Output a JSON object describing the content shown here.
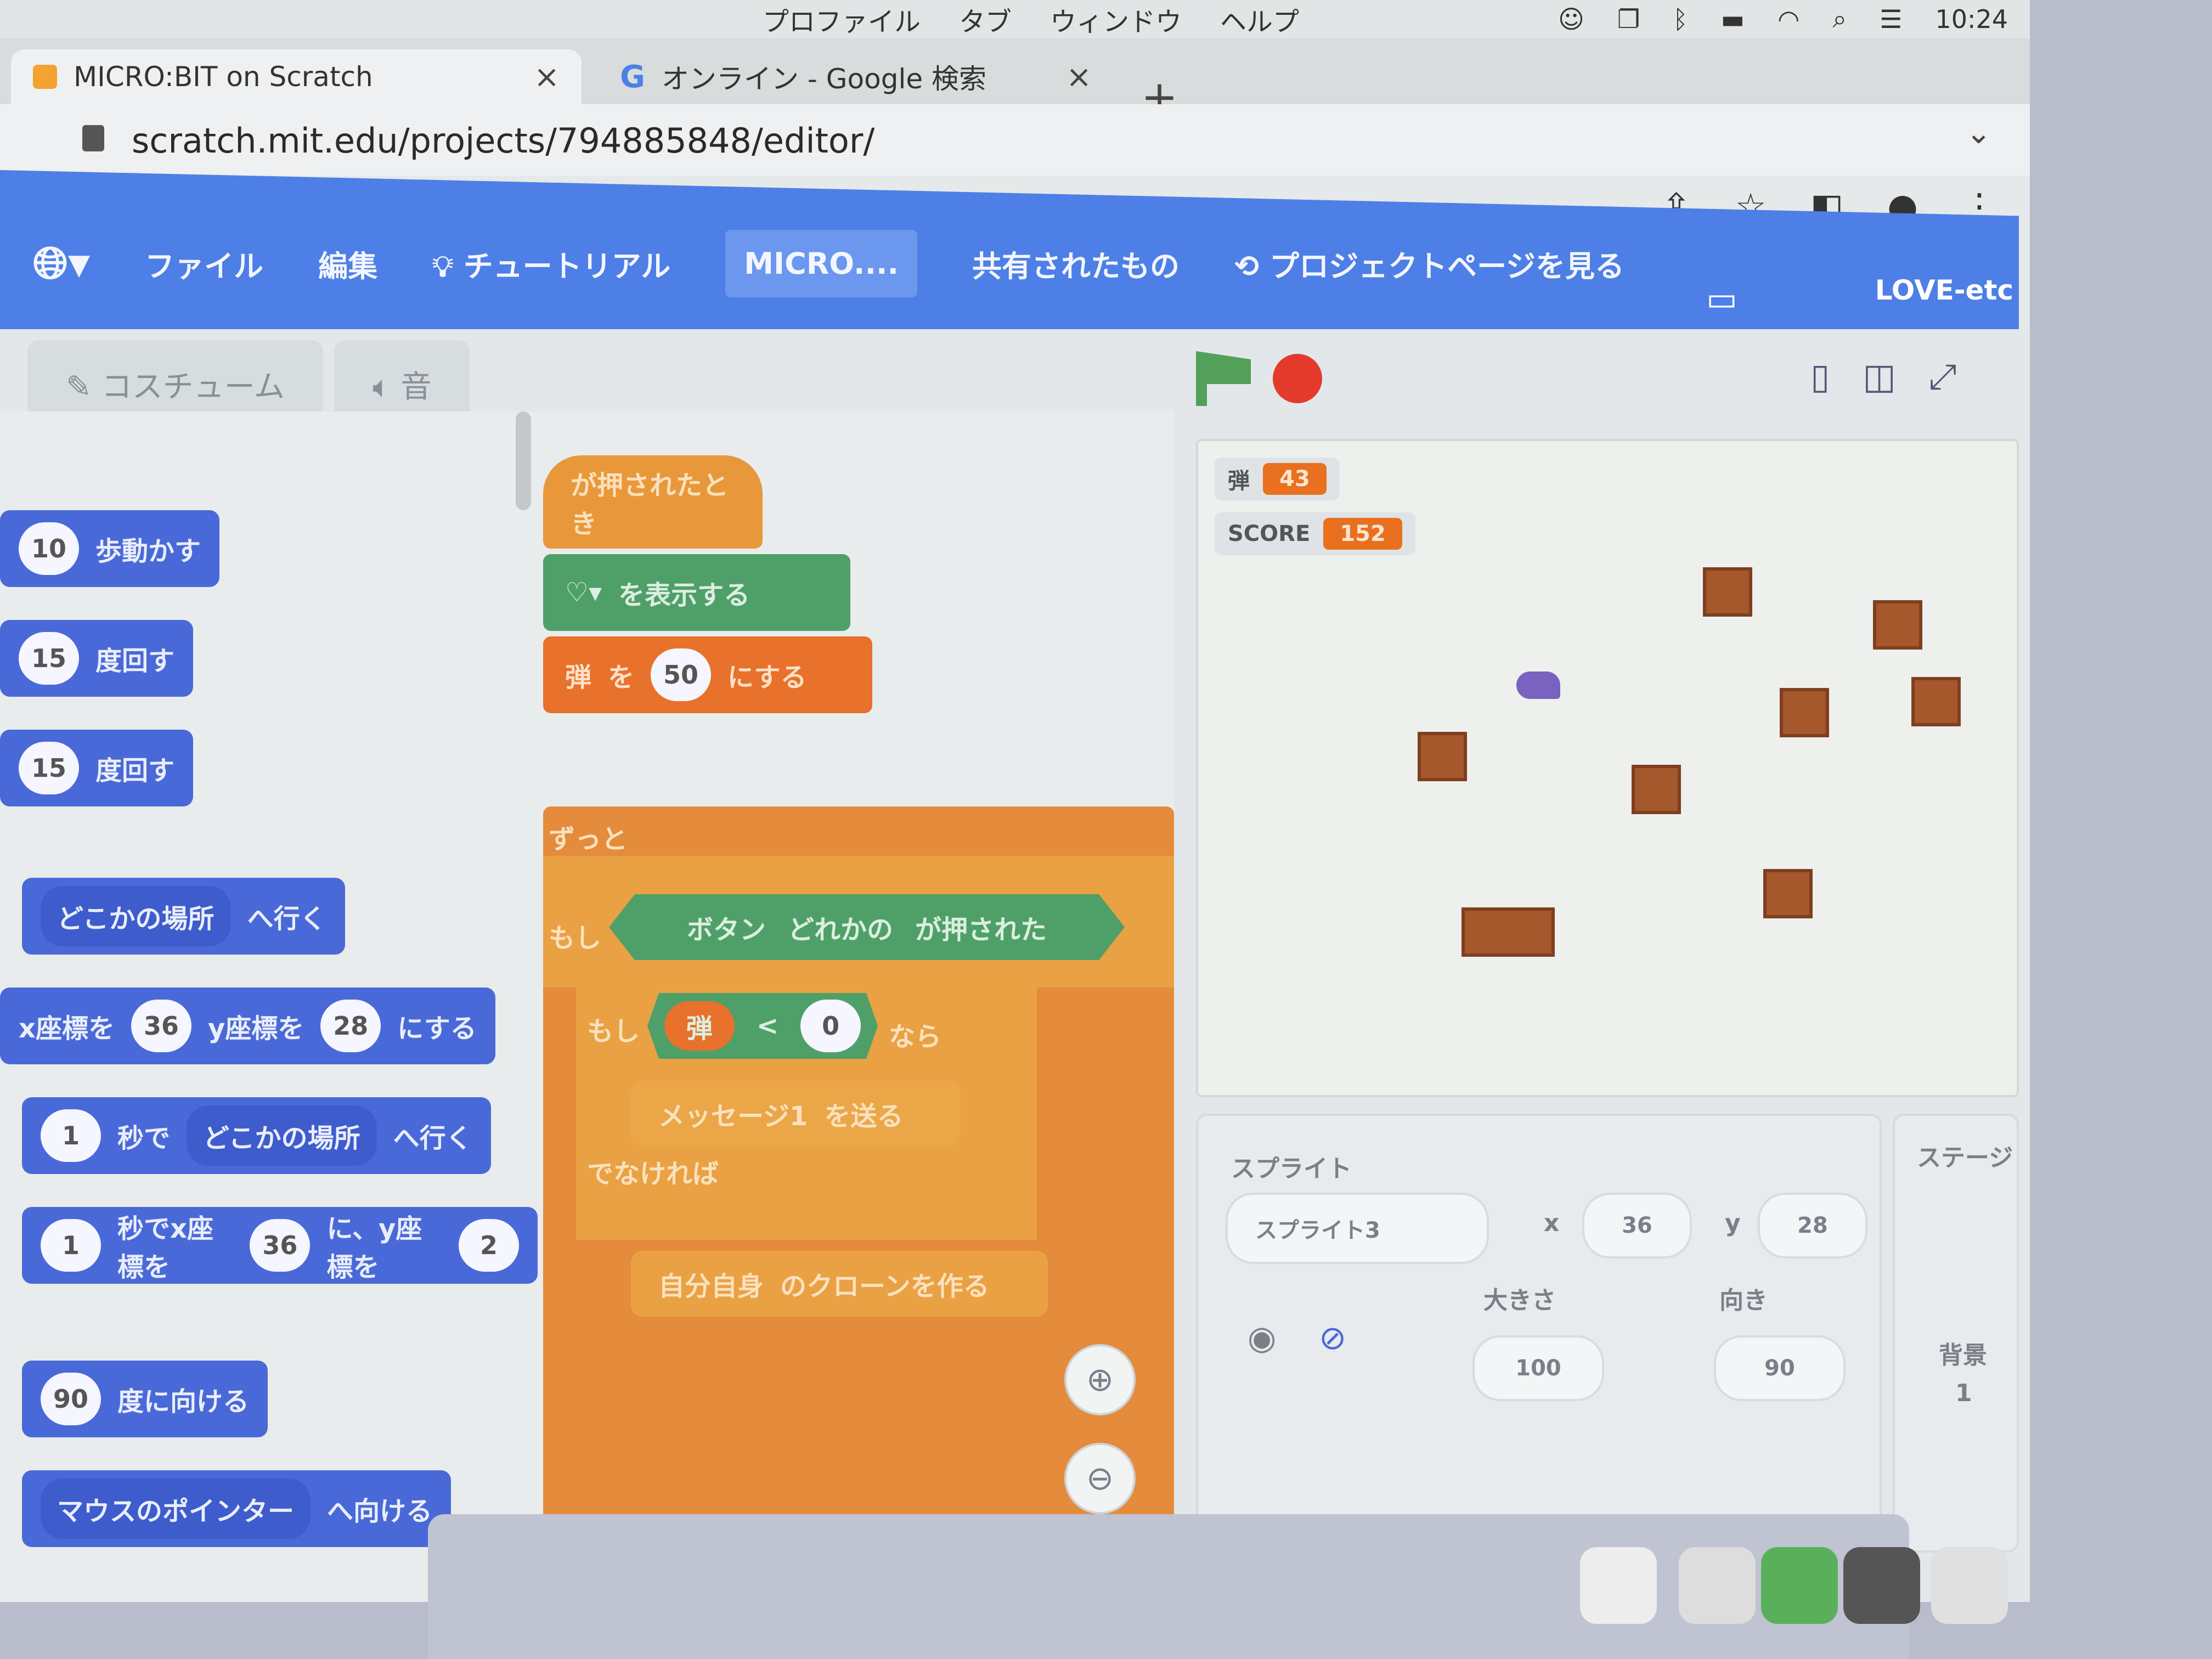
{
  "macos": {
    "menu_items": [
      "プロファイル",
      "タブ",
      "ウィンドウ",
      "ヘルプ"
    ],
    "clock": "10:24",
    "status_icons": [
      "user-icon",
      "window-icon",
      "bluetooth-icon",
      "battery-icon",
      "wifi-icon",
      "search-icon",
      "control-center-icon"
    ]
  },
  "browser": {
    "tabs": [
      {
        "title": "MICRO:BIT on Scratch",
        "close": "×"
      },
      {
        "title": "オンライン - Google 検索",
        "close": "×"
      }
    ],
    "new_tab": "+",
    "url": "scratch.mit.edu/projects/794885848/editor/"
  },
  "scratch_menu": {
    "file": "ファイル",
    "edit": "編集",
    "tutorials": "チュートリアル",
    "project_title": "MICRO....",
    "shared": "共有されたもの",
    "see_project_page": "プロジェクトページを見る",
    "user": "LOVE-etc"
  },
  "editor_tabs": {
    "costumes": "コスチューム",
    "sounds": "音"
  },
  "palette": {
    "move": {
      "value": "10",
      "label": "歩動かす"
    },
    "turn_right": {
      "value": "15",
      "label": "度回す"
    },
    "turn_left": {
      "value": "15",
      "label": "度回す"
    },
    "goto": {
      "dropdown": "どこかの場所",
      "label": "へ行く"
    },
    "set_xy": {
      "x_label": "x座標を",
      "x": "36",
      "y_label": "y座標を",
      "y": "28",
      "suffix": "にする"
    },
    "glide_random": {
      "secs": "1",
      "label": "秒で",
      "dropdown": "どこかの場所",
      "suffix": "へ行く"
    },
    "glide_xy": {
      "secs": "1",
      "label": "秒でx座標を",
      "x": "36",
      "mid": "に、y座標を",
      "y": "2"
    },
    "point_dir": {
      "value": "90",
      "label": "度に向ける"
    },
    "point_towards": {
      "dropdown": "マウスのポインター",
      "label": "へ向ける"
    }
  },
  "script": {
    "hat": "が押されたとき",
    "show_icon": "を表示する",
    "set_var": {
      "var": "弾",
      "to": "を",
      "value": "50",
      "suffix": "にする"
    },
    "forever": "ずっと",
    "if1": {
      "label": "もし",
      "cond_prefix": "ボタン",
      "cond_dropdown": "どれかの",
      "cond_suffix": "が押された"
    },
    "if2": {
      "label": "もし",
      "var": "弾",
      "op": "<",
      "value": "0",
      "suffix": "なら"
    },
    "broadcast": {
      "dropdown": "メッセージ1",
      "label": "を送る"
    },
    "else": "でなければ",
    "clone": {
      "dropdown": "自分自身",
      "label": "のクローンを作る"
    }
  },
  "stage": {
    "variables": [
      {
        "name": "弾",
        "value": "43"
      },
      {
        "name": "SCORE",
        "value": "152"
      }
    ]
  },
  "sprite_info": {
    "heading": "スプライト",
    "name": "スプライト3",
    "x_label": "x",
    "x": "36",
    "y_label": "y",
    "y": "28",
    "size_label": "大きさ",
    "size": "100",
    "direction_label": "向き",
    "direction": "90"
  },
  "stage_pane": {
    "title": "ステージ",
    "backdrops_label": "背景",
    "backdrops_count": "1"
  },
  "colors": {
    "motion": "#4a69d8",
    "events": "#e8983a",
    "control": "#e48b3c",
    "operators": "#4fa068",
    "scratch_menu": "#4d7fe6",
    "stop": "#e33a2c"
  }
}
